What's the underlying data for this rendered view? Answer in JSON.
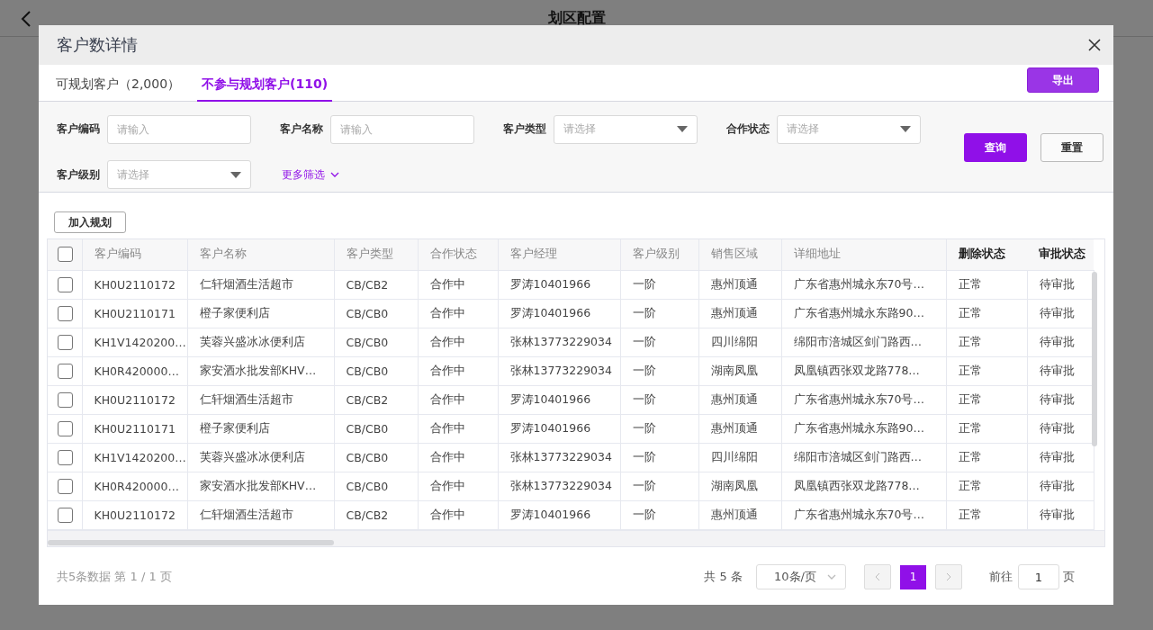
{
  "page": {
    "title": "划区配置"
  },
  "dialog": {
    "title": "客户数详情",
    "tabs": [
      {
        "label": "可规划客户（2,000）",
        "selected": false
      },
      {
        "label": "不参与规划客户(110)",
        "selected": true
      }
    ],
    "export_button": "导出",
    "filters": [
      {
        "label": "客户编码",
        "kind": "input",
        "placeholder": "请输入"
      },
      {
        "label": "客户名称",
        "kind": "input",
        "placeholder": "请输入"
      },
      {
        "label": "客户类型",
        "kind": "select",
        "placeholder": "请选择"
      },
      {
        "label": "合作状态",
        "kind": "select",
        "placeholder": "请选择"
      },
      {
        "label": "客户级别",
        "kind": "select",
        "placeholder": "请选择"
      }
    ],
    "more_filters": "更多筛选",
    "query_button": "查询",
    "reset_button": "重置",
    "add_button": "加入规划",
    "table": {
      "all_checked": false,
      "columns": [
        {
          "label": "客户编码",
          "fixed": false
        },
        {
          "label": "客户名称",
          "fixed": false
        },
        {
          "label": "客户类型",
          "fixed": false
        },
        {
          "label": "合作状态",
          "fixed": false
        },
        {
          "label": "客户经理",
          "fixed": false
        },
        {
          "label": "客户级别",
          "fixed": false
        },
        {
          "label": "销售区域",
          "fixed": false
        },
        {
          "label": "详细地址",
          "fixed": false
        },
        {
          "label": "删除状态",
          "fixed": true
        },
        {
          "label": "审批状态",
          "fixed": true
        }
      ],
      "rows": [
        {
          "checked": false,
          "cells": [
            "KH0U2110172",
            "仁轩烟酒生活超市",
            "CB/CB2",
            "合作中",
            "罗涛10401966",
            "一阶",
            "惠州顶通",
            "广东省惠州城永东70号…",
            "正常",
            "待审批"
          ]
        },
        {
          "checked": false,
          "cells": [
            "KH0U2110171",
            "橙子家便利店",
            "CB/CB0",
            "合作中",
            "罗涛10401966",
            "一阶",
            "惠州顶通",
            "广东省惠州城永东路90…",
            "正常",
            "待审批"
          ]
        },
        {
          "checked": false,
          "cells": [
            "KH1V1420200…",
            "芙蓉兴盛冰冰便利店",
            "CB/CB0",
            "合作中",
            "张林13773229034",
            "一阶",
            "四川绵阳",
            "绵阳市涪城区剑门路西…",
            "正常",
            "待审批"
          ]
        },
        {
          "checked": false,
          "cells": [
            "KH0R420000…",
            "家安酒水批发部KHV…",
            "CB/CB0",
            "合作中",
            "张林13773229034",
            "一阶",
            "湖南凤凰",
            "凤凰镇西张双龙路778…",
            "正常",
            "待审批"
          ]
        },
        {
          "checked": false,
          "cells": [
            "KH0U2110172",
            "仁轩烟酒生活超市",
            "CB/CB2",
            "合作中",
            "罗涛10401966",
            "一阶",
            "惠州顶通",
            "广东省惠州城永东70号…",
            "正常",
            "待审批"
          ]
        },
        {
          "checked": false,
          "cells": [
            "KH0U2110171",
            "橙子家便利店",
            "CB/CB0",
            "合作中",
            "罗涛10401966",
            "一阶",
            "惠州顶通",
            "广东省惠州城永东路90…",
            "正常",
            "待审批"
          ]
        },
        {
          "checked": false,
          "cells": [
            "KH1V1420200…",
            "芙蓉兴盛冰冰便利店",
            "CB/CB0",
            "合作中",
            "张林13773229034",
            "一阶",
            "四川绵阳",
            "绵阳市涪城区剑门路西…",
            "正常",
            "待审批"
          ]
        },
        {
          "checked": false,
          "cells": [
            "KH0R420000…",
            "家安酒水批发部KHV…",
            "CB/CB0",
            "合作中",
            "张林13773229034",
            "一阶",
            "湖南凤凰",
            "凤凰镇西张双龙路778…",
            "正常",
            "待审批"
          ]
        },
        {
          "checked": false,
          "cells": [
            "KH0U2110172",
            "仁轩烟酒生活超市",
            "CB/CB2",
            "合作中",
            "罗涛10401966",
            "一阶",
            "惠州顶通",
            "广东省惠州城永东70号…",
            "正常",
            "待审批"
          ]
        }
      ]
    },
    "pagination": {
      "summary": "共5条数据 第 1 / 1 页",
      "total": "共 5 条",
      "page_size": "10条/页",
      "pages": [
        {
          "label": "1",
          "selected": true
        }
      ],
      "goto_label": "前往",
      "goto_value": "1",
      "goto_suffix": "页"
    }
  }
}
